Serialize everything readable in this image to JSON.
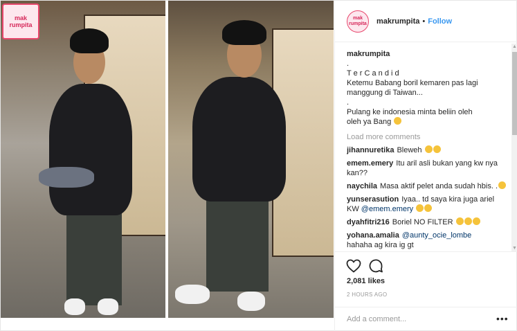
{
  "watermark": {
    "line1": "mak",
    "line2": "rumpita"
  },
  "header": {
    "avatar_text": "mak rumpita",
    "username": "makrumpita",
    "dot": "•",
    "follow_label": "Follow"
  },
  "caption": {
    "username": "makrumpita",
    "lines": [
      ".",
      "T e r C a n d i d",
      "Ketemu Babang boril kemaren pas lagi",
      "manggung di Taiwan...",
      ".",
      "Pulang ke indonesia minta beliin oleh",
      "oleh ya Bang"
    ]
  },
  "load_more": "Load more comments",
  "comments": [
    {
      "user": "jihannuretika",
      "text": "Bleweh",
      "mention": "",
      "after": ""
    },
    {
      "user": "emem.emery",
      "text": "Itu aril asli bukan yang kw nya kan??",
      "mention": "",
      "after": ""
    },
    {
      "user": "naychila",
      "text": "Masa aktif pelet anda sudah hbis. .",
      "mention": "",
      "after": ""
    },
    {
      "user": "yunserasution",
      "text": "Iyaa.. td saya kira juga ariel KW",
      "mention": "@emem.emery",
      "after": ""
    },
    {
      "user": "dyahfitri216",
      "text": "Boriel NO FILTER",
      "mention": "",
      "after": ""
    },
    {
      "user": "yohana.amalia",
      "text": "",
      "mention": "@aunty_ocie_lombe",
      "after": "hahaha ag kira ig gt"
    }
  ],
  "likes": "2,081 likes",
  "time": "2 HOURS AGO",
  "add_comment_placeholder": "Add a comment...",
  "more_dots": "•••",
  "scroll_up": "▲",
  "scroll_down": "▼",
  "icons": {
    "like": "heart-icon",
    "comment": "comment-bubble-icon"
  },
  "colors": {
    "accent": "#3897f0",
    "watermark": "#e8466c"
  }
}
